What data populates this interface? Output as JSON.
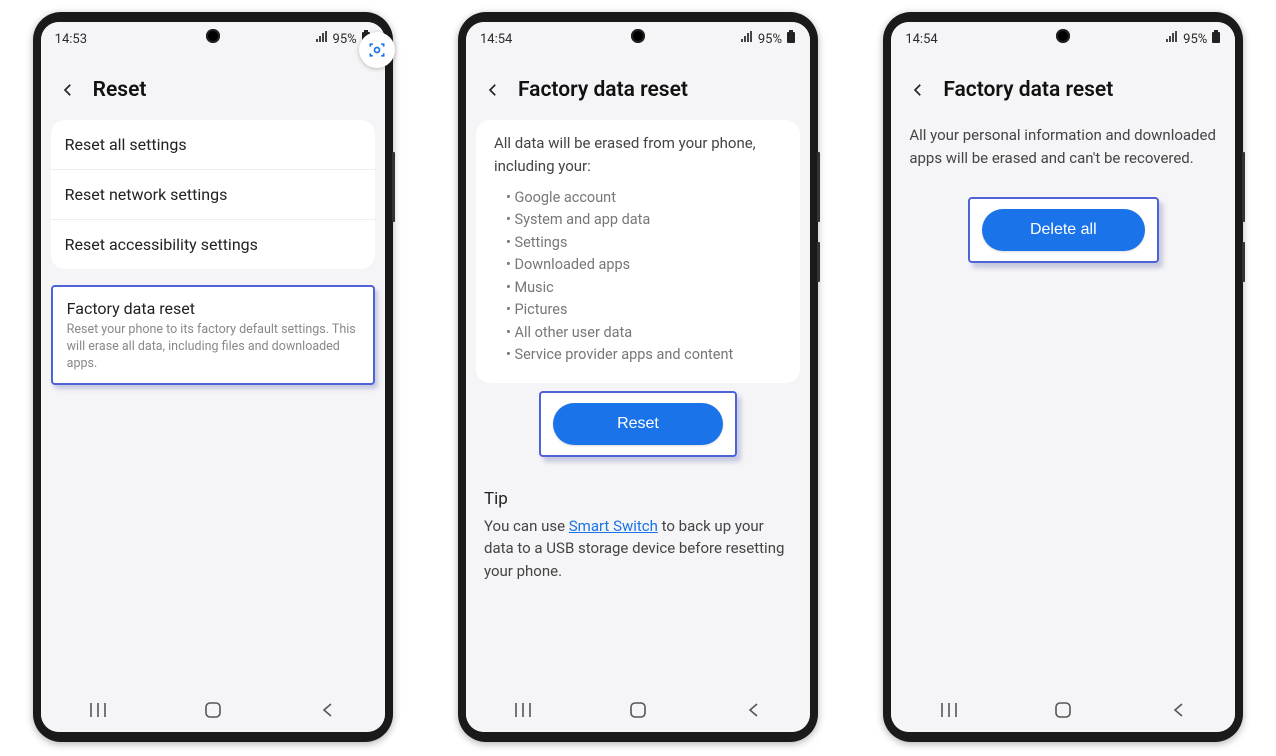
{
  "phone1": {
    "time": "14:53",
    "battery": "95%",
    "header_title": "Reset",
    "items": [
      "Reset all settings",
      "Reset network settings",
      "Reset accessibility settings"
    ],
    "factory": {
      "title": "Factory data reset",
      "subtitle": "Reset your phone to its factory default settings. This will erase all data, including files and downloaded apps."
    }
  },
  "phone2": {
    "time": "14:54",
    "battery": "95%",
    "header_title": "Factory data reset",
    "intro": "All data will be erased from your phone, including your:",
    "erase_items": [
      "Google account",
      "System and app data",
      "Settings",
      "Downloaded apps",
      "Music",
      "Pictures",
      "All other user data",
      "Service provider apps and content"
    ],
    "reset_btn": "Reset",
    "tip_heading": "Tip",
    "tip_before": "You can use ",
    "tip_link": "Smart Switch",
    "tip_after": " to back up your data to a USB storage device before resetting your phone."
  },
  "phone3": {
    "time": "14:54",
    "battery": "95%",
    "header_title": "Factory data reset",
    "body": "All your personal information and downloaded apps will be erased and can't be recovered.",
    "delete_btn": "Delete all"
  }
}
